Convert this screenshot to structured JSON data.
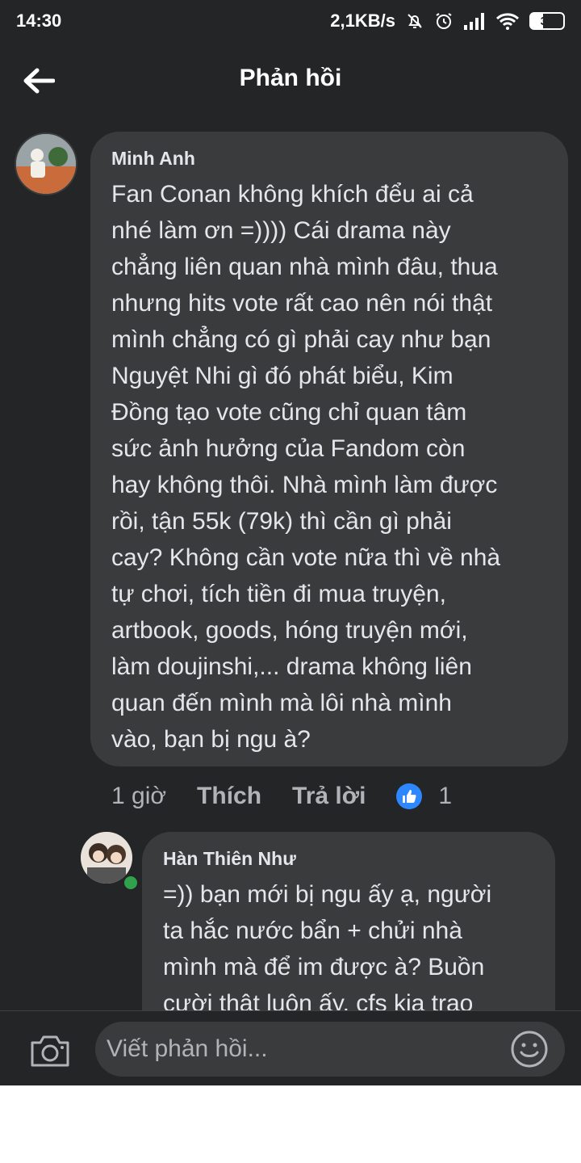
{
  "status_bar": {
    "time": "14:30",
    "network_speed": "2,1KB/s",
    "battery": "37",
    "icons": [
      "mute-bell-icon",
      "alarm-icon",
      "signal-icon",
      "wifi-icon",
      "battery-icon"
    ]
  },
  "header": {
    "title": "Phản hồi",
    "back_icon": "back-arrow-icon"
  },
  "comment": {
    "author": "Minh Anh",
    "text": "Fan Conan không khích đểu ai cả\nnhé làm ơn =)))) Cái drama này\nchẳng liên quan nhà mình đâu, thua\nnhưng hits vote rất cao nên nói thật\nmình chẳng có gì phải cay như bạn\nNguyệt Nhi gì đó phát biểu, Kim\nĐồng tạo vote cũng chỉ quan tâm\nsức ảnh hưởng của Fandom còn\nhay không thôi. Nhà mình làm được\nrồi, tận 55k (79k) thì cần gì phải\ncay? Không cần vote nữa thì về nhà\ntự chơi, tích tiền đi mua truyện,\nartbook, goods, hóng truyện mới,\nlàm doujinshi,... drama không liên\nquan đến mình mà lôi nhà mình\nvào, bạn bị ngu à?",
    "time": "1 giờ",
    "like_label": "Thích",
    "reply_label": "Trả lời",
    "like_count": "1"
  },
  "reply": {
    "author": "Hàn Thiên Như",
    "text": "=)) bạn mới bị ngu ấy ạ, người\nta hắc nước bẩn + chửi nhà\nmình mà để im được à? Buồn\ncười thật luôn ấy, cfs kia trao",
    "online": true
  },
  "composer": {
    "placeholder": "Viết phản hồi...",
    "camera_icon": "camera-icon",
    "emoji_icon": "emoji-icon"
  },
  "colors": {
    "background": "#242526",
    "bubble": "#3a3b3c",
    "text": "#e4e6eb",
    "secondary_text": "#b0b3b8",
    "like_blue": "#2d88ff",
    "online_green": "#31a24c"
  }
}
